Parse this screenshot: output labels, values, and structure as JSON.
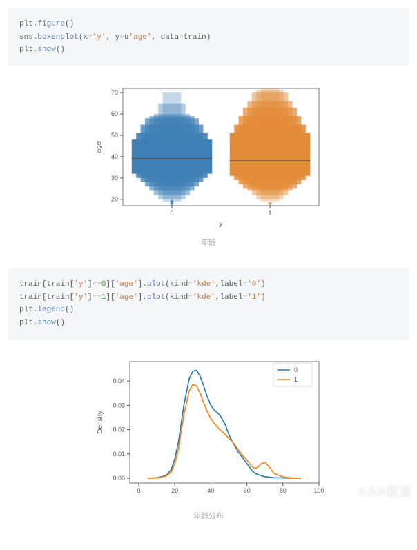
{
  "code1": {
    "line1a": "plt.",
    "line1b": "figure",
    "line1c": "()",
    "line2a": "sns.",
    "line2b": "boxenplot",
    "line2c": "(x=",
    "line2d": "'y'",
    "line2e": ", y=u",
    "line2f": "'age'",
    "line2g": ", data=train)",
    "line3a": "plt.",
    "line3b": "show",
    "line3c": "()"
  },
  "caption1": "年龄",
  "code2": {
    "line1a": "train[train[",
    "line1b": "'y'",
    "line1c": "]==",
    "line1d": "0",
    "line1e": "][",
    "line1f": "'age'",
    "line1g": "].",
    "line1h": "plot",
    "line1i": "(kind=",
    "line1j": "'kde'",
    "line1k": ",label=",
    "line1l": "'0'",
    "line1m": ")",
    "line2a": "train[train[",
    "line2b": "'y'",
    "line2c": "]==",
    "line2d": "1",
    "line2e": "][",
    "line2f": "'age'",
    "line2g": "].",
    "line2h": "plot",
    "line2i": "(kind=",
    "line2j": "'kde'",
    "line2k": ",label=",
    "line2l": "'1'",
    "line2m": ")",
    "line3a": "plt.",
    "line3b": "legend",
    "line3c": "()",
    "line4a": "plt.",
    "line4b": "show",
    "line4c": "()"
  },
  "caption2": "年龄分布",
  "chart_data": [
    {
      "type": "boxen",
      "xlabel": "y",
      "ylabel": "age",
      "x_categories": [
        "0",
        "1"
      ],
      "y_ticks": [
        20,
        30,
        40,
        50,
        60,
        70
      ],
      "ylim": [
        17,
        72
      ],
      "series": [
        {
          "name": "0",
          "color": "#3f7fb5",
          "median": 39,
          "levels": [
            {
              "low": 32,
              "high": 48
            },
            {
              "low": 30,
              "high": 51
            },
            {
              "low": 28,
              "high": 55
            },
            {
              "low": 26,
              "high": 58
            },
            {
              "low": 24,
              "high": 59
            },
            {
              "low": 22,
              "high": 60
            },
            {
              "low": 20,
              "high": 65
            },
            {
              "low": 19,
              "high": 70
            }
          ],
          "outliers": [
            18,
            19
          ]
        },
        {
          "name": "1",
          "color": "#e28b38",
          "median": 38,
          "levels": [
            {
              "low": 31,
              "high": 51
            },
            {
              "low": 29,
              "high": 55
            },
            {
              "low": 27,
              "high": 59
            },
            {
              "low": 25,
              "high": 63
            },
            {
              "low": 24,
              "high": 66
            },
            {
              "low": 22,
              "high": 70
            },
            {
              "low": 20,
              "high": 71
            },
            {
              "low": 19,
              "high": 72
            }
          ],
          "outliers": [
            18
          ]
        }
      ]
    },
    {
      "type": "line",
      "subtype": "kde",
      "xlabel": "",
      "ylabel": "Density",
      "x_ticks": [
        0,
        20,
        40,
        60,
        80,
        100
      ],
      "y_ticks": [
        0.0,
        0.01,
        0.02,
        0.03,
        0.04
      ],
      "xlim": [
        -5,
        100
      ],
      "ylim": [
        -0.002,
        0.048
      ],
      "legend": [
        "0",
        "1"
      ],
      "series": [
        {
          "name": "0",
          "color": "#1f77b4",
          "x": [
            5,
            10,
            15,
            18,
            20,
            22,
            25,
            28,
            30,
            32,
            34,
            36,
            38,
            40,
            42,
            45,
            48,
            50,
            52,
            55,
            58,
            60,
            63,
            65,
            68,
            70,
            75,
            80,
            85,
            90
          ],
          "y": [
            0.0,
            0.0002,
            0.001,
            0.0035,
            0.008,
            0.015,
            0.03,
            0.041,
            0.044,
            0.0445,
            0.042,
            0.038,
            0.0335,
            0.03,
            0.028,
            0.026,
            0.022,
            0.018,
            0.015,
            0.011,
            0.008,
            0.006,
            0.003,
            0.0018,
            0.001,
            0.0006,
            0.0002,
            0.0001,
            0.0,
            0.0
          ]
        },
        {
          "name": "1",
          "color": "#ff7f0e",
          "x": [
            5,
            10,
            15,
            18,
            20,
            22,
            25,
            28,
            30,
            32,
            34,
            36,
            38,
            40,
            42,
            45,
            48,
            50,
            52,
            55,
            58,
            60,
            62,
            64,
            66,
            68,
            70,
            72,
            75,
            80,
            85,
            90
          ],
          "y": [
            0.0,
            0.0001,
            0.0008,
            0.0025,
            0.006,
            0.012,
            0.026,
            0.036,
            0.0385,
            0.038,
            0.035,
            0.031,
            0.0275,
            0.0245,
            0.0225,
            0.02,
            0.018,
            0.0165,
            0.015,
            0.012,
            0.009,
            0.0075,
            0.0055,
            0.004,
            0.0045,
            0.006,
            0.0065,
            0.005,
            0.002,
            0.0005,
            0.0001,
            0.0
          ]
        }
      ]
    }
  ],
  "watermark": "AAA教育"
}
